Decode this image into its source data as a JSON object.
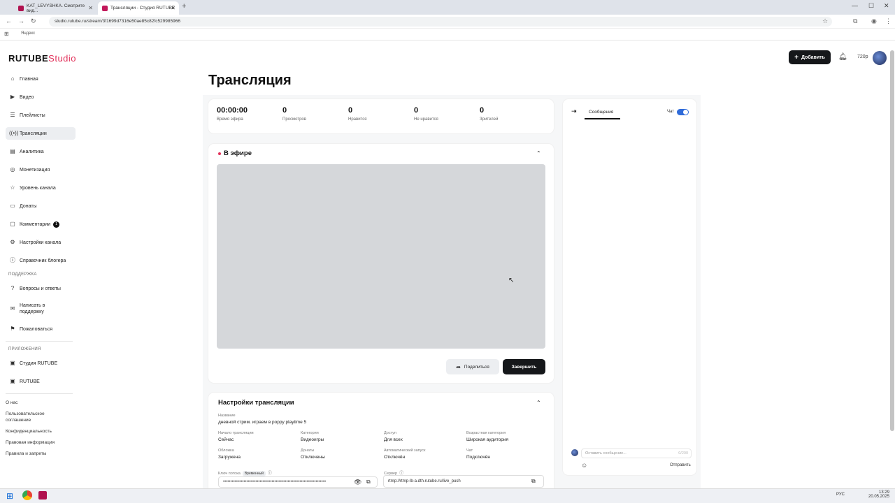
{
  "browser": {
    "tabs": [
      {
        "title": "KAT_LEVYSHKA. Смотрите вид..."
      },
      {
        "title": "Трансляции - Студия RUTUBE"
      }
    ],
    "url": "studio.rutube.ru/stream/3f1699d7316e50ae85c82fc529985966",
    "bookmark": "Яндекс"
  },
  "logo": {
    "brand": "RUTUBE",
    "suffix": "Studio"
  },
  "header": {
    "add_label": "Добавить",
    "quality": "720p"
  },
  "sidebar": {
    "items": [
      {
        "label": "Главная",
        "icon": "home-icon"
      },
      {
        "label": "Видео",
        "icon": "video-icon"
      },
      {
        "label": "Плейлисты",
        "icon": "playlist-icon"
      },
      {
        "label": "Трансляции",
        "icon": "broadcast-icon"
      },
      {
        "label": "Аналитика",
        "icon": "chart-icon"
      },
      {
        "label": "Монетизация",
        "icon": "coin-icon"
      },
      {
        "label": "Уровень канала",
        "icon": "star-icon"
      },
      {
        "label": "Донаты",
        "icon": "wallet-icon"
      },
      {
        "label": "Комментарии",
        "icon": "comment-icon",
        "badge": "1"
      },
      {
        "label": "Настройки канала",
        "icon": "gear-icon"
      },
      {
        "label": "Справочник блогера",
        "icon": "info-icon"
      }
    ],
    "support_heading": "ПОДДЕРЖКА",
    "support": [
      {
        "label": "Вопросы и ответы",
        "icon": "question-icon"
      },
      {
        "label": "Написать в поддержку",
        "icon": "mail-icon"
      },
      {
        "label": "Пожаловаться",
        "icon": "flag-icon"
      }
    ],
    "apps_heading": "ПРИЛОЖЕНИЯ",
    "apps": [
      {
        "label": "Студия RUTUBE",
        "icon": "studio-icon"
      },
      {
        "label": "RUTUBE",
        "icon": "rutube-icon"
      }
    ],
    "footer_links": [
      "О нас",
      "Пользовательское соглашение",
      "Конфиденциальность",
      "Правовая информация",
      "Правила и запреты"
    ]
  },
  "page": {
    "title": "Трансляция"
  },
  "stats": [
    {
      "value": "00:00:00",
      "label": "Время эфира"
    },
    {
      "value": "0",
      "label": "Просмотров"
    },
    {
      "value": "0",
      "label": "Нравится"
    },
    {
      "value": "0",
      "label": "Не нравится"
    },
    {
      "value": "0",
      "label": "Зрителей"
    }
  ],
  "live": {
    "title": "В эфире",
    "share_label": "Поделиться",
    "end_label": "Завершить"
  },
  "settings": {
    "title": "Настройки трансляции",
    "name_label": "Название",
    "name_value": "дневной стрим. играем в poppy playtime 5",
    "fields": [
      {
        "k": "Начало трансляции",
        "v": "Сейчас"
      },
      {
        "k": "Категория",
        "v": "Видеоигры"
      },
      {
        "k": "Доступ",
        "v": "Для всех"
      },
      {
        "k": "Возрастная категория",
        "v": "Широкая аудитория"
      },
      {
        "k": "Обложка",
        "v": "Загружена"
      },
      {
        "k": "Донаты",
        "v": "Отключены"
      },
      {
        "k": "Автоматический запуск",
        "v": "Отключён"
      },
      {
        "k": "Чат",
        "v": "Подключён"
      }
    ],
    "key_label": "Ключ потока",
    "key_badge": "Временный",
    "key_value": "••••••••••••••••••••••••••••••••••••••••••••••••••••••••••••••••••••••",
    "server_label": "Сервер",
    "server_value": "rtmp://rtmp-lb-a.dth.rutube.ru/live_push"
  },
  "chat": {
    "tab": "Сообщения",
    "toggle_label": "Чат",
    "input_placeholder": "Оставить сообщение...",
    "counter": "0/200",
    "send_label": "Отправить"
  },
  "taskbar": {
    "lang": "РУС",
    "time": "13:29",
    "date": "20.05.2025"
  }
}
